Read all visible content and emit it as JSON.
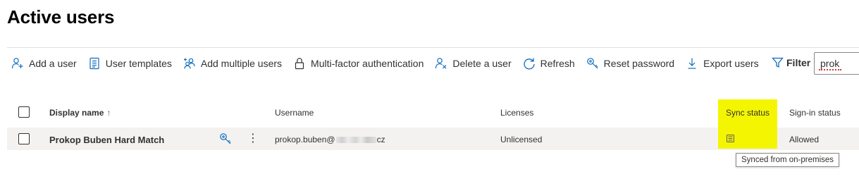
{
  "page": {
    "title": "Active users"
  },
  "toolbar": {
    "buttons": [
      {
        "label": "Add a user",
        "icon": "add-person-icon"
      },
      {
        "label": "User templates",
        "icon": "template-icon"
      },
      {
        "label": "Add multiple users",
        "icon": "add-group-icon"
      },
      {
        "label": "Multi-factor authentication",
        "icon": "lock-icon"
      },
      {
        "label": "Delete a user",
        "icon": "delete-person-icon"
      },
      {
        "label": "Refresh",
        "icon": "refresh-icon"
      },
      {
        "label": "Reset password",
        "icon": "key-icon"
      },
      {
        "label": "Export users",
        "icon": "download-icon"
      }
    ],
    "filter_label": "Filter",
    "search_value": "prok"
  },
  "table": {
    "columns": {
      "display_name": "Display name",
      "display_name_sort": "↑",
      "username": "Username",
      "licenses": "Licenses",
      "sync_status": "Sync status",
      "signin_status": "Sign-in status"
    },
    "rows": [
      {
        "display_name": "Prokop Buben Hard Match",
        "username_prefix": "prokop.buben@",
        "username_suffix": "cz",
        "licenses": "Unlicensed",
        "sync_icon": "directory-sync-icon",
        "signin_status": "Allowed"
      }
    ]
  },
  "tooltip": {
    "text": "Synced from on-premises"
  },
  "colors": {
    "highlight": "#f4f500",
    "row_background": "#f3f2f1",
    "icon_blue": "#0f6cbd"
  }
}
